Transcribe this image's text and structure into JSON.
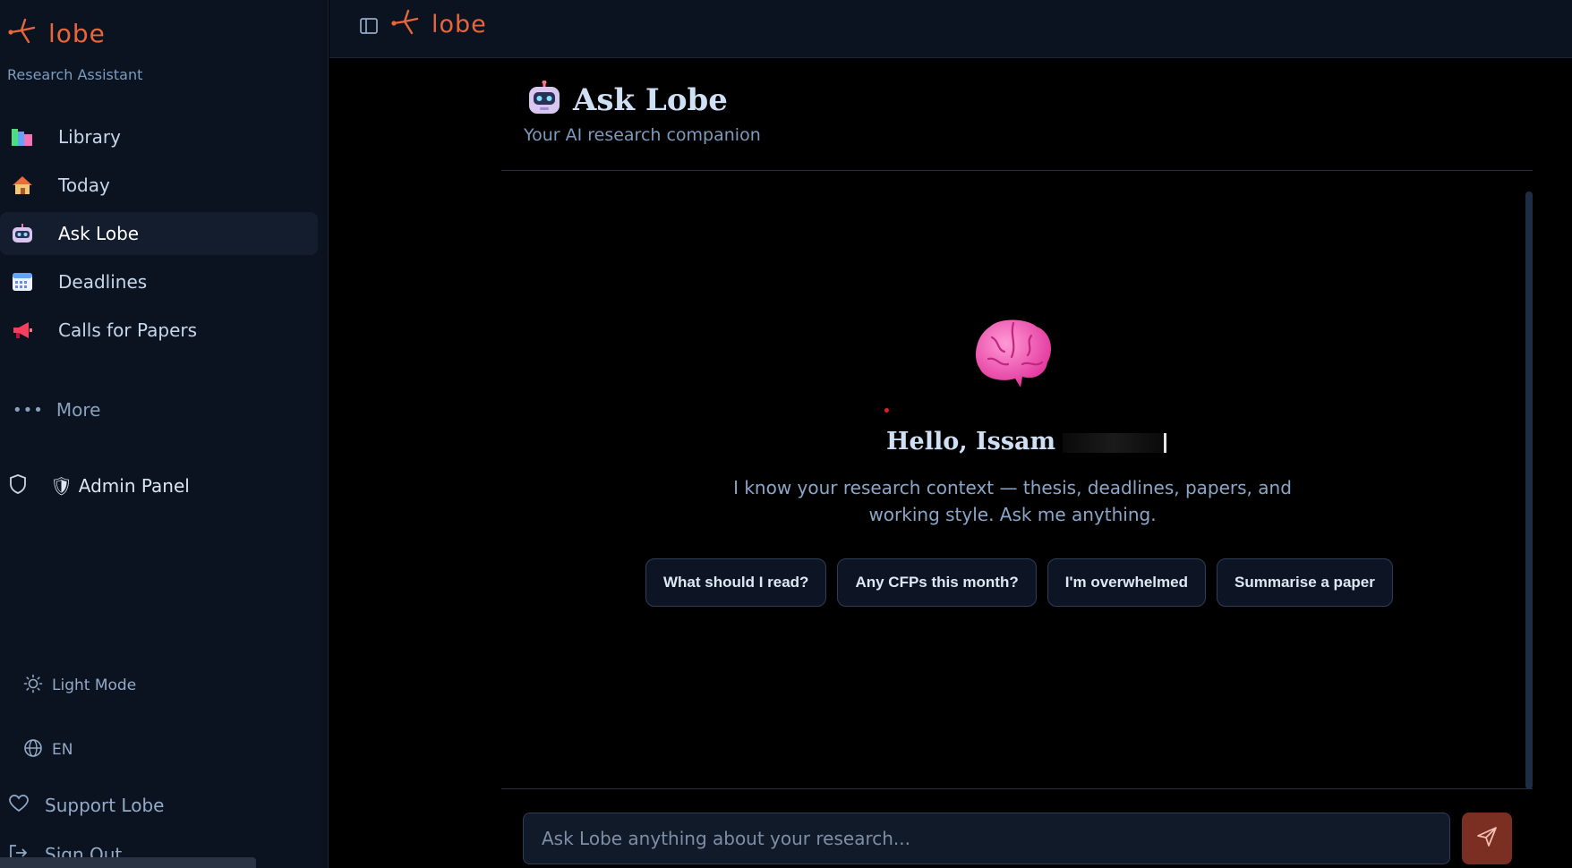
{
  "app": {
    "name": "lobe",
    "subtitle": "Research Assistant"
  },
  "sidebar": {
    "items": [
      {
        "label": "Library",
        "icon": "books-icon"
      },
      {
        "label": "Today",
        "icon": "house-icon"
      },
      {
        "label": "Ask Lobe",
        "icon": "robot-icon",
        "active": true
      },
      {
        "label": "Deadlines",
        "icon": "calendar-icon"
      },
      {
        "label": "Calls for Papers",
        "icon": "megaphone-icon"
      }
    ],
    "more_label": "More",
    "admin_label": "🛡 Admin Panel",
    "light_mode_label": "Light Mode",
    "language_label": "EN",
    "support_label": "Support Lobe",
    "signout_label": "Sign Out"
  },
  "topbar": {
    "brand": "lobe"
  },
  "page": {
    "title": "Ask Lobe",
    "subtitle": "Your AI research companion"
  },
  "chat": {
    "greeting": "Hello, Issam",
    "intro": "I know your research context — thesis, deadlines, papers, and working style. Ask me anything.",
    "suggestions": [
      "What should I read?",
      "Any CFPs this month?",
      "I'm overwhelmed",
      "Summarise a paper"
    ],
    "input_placeholder": "Ask Lobe anything about your research..."
  },
  "colors": {
    "accent": "#e8663a",
    "background": "#000000",
    "sidebar_bg": "#0b1220",
    "send_button": "#7a2f22"
  }
}
